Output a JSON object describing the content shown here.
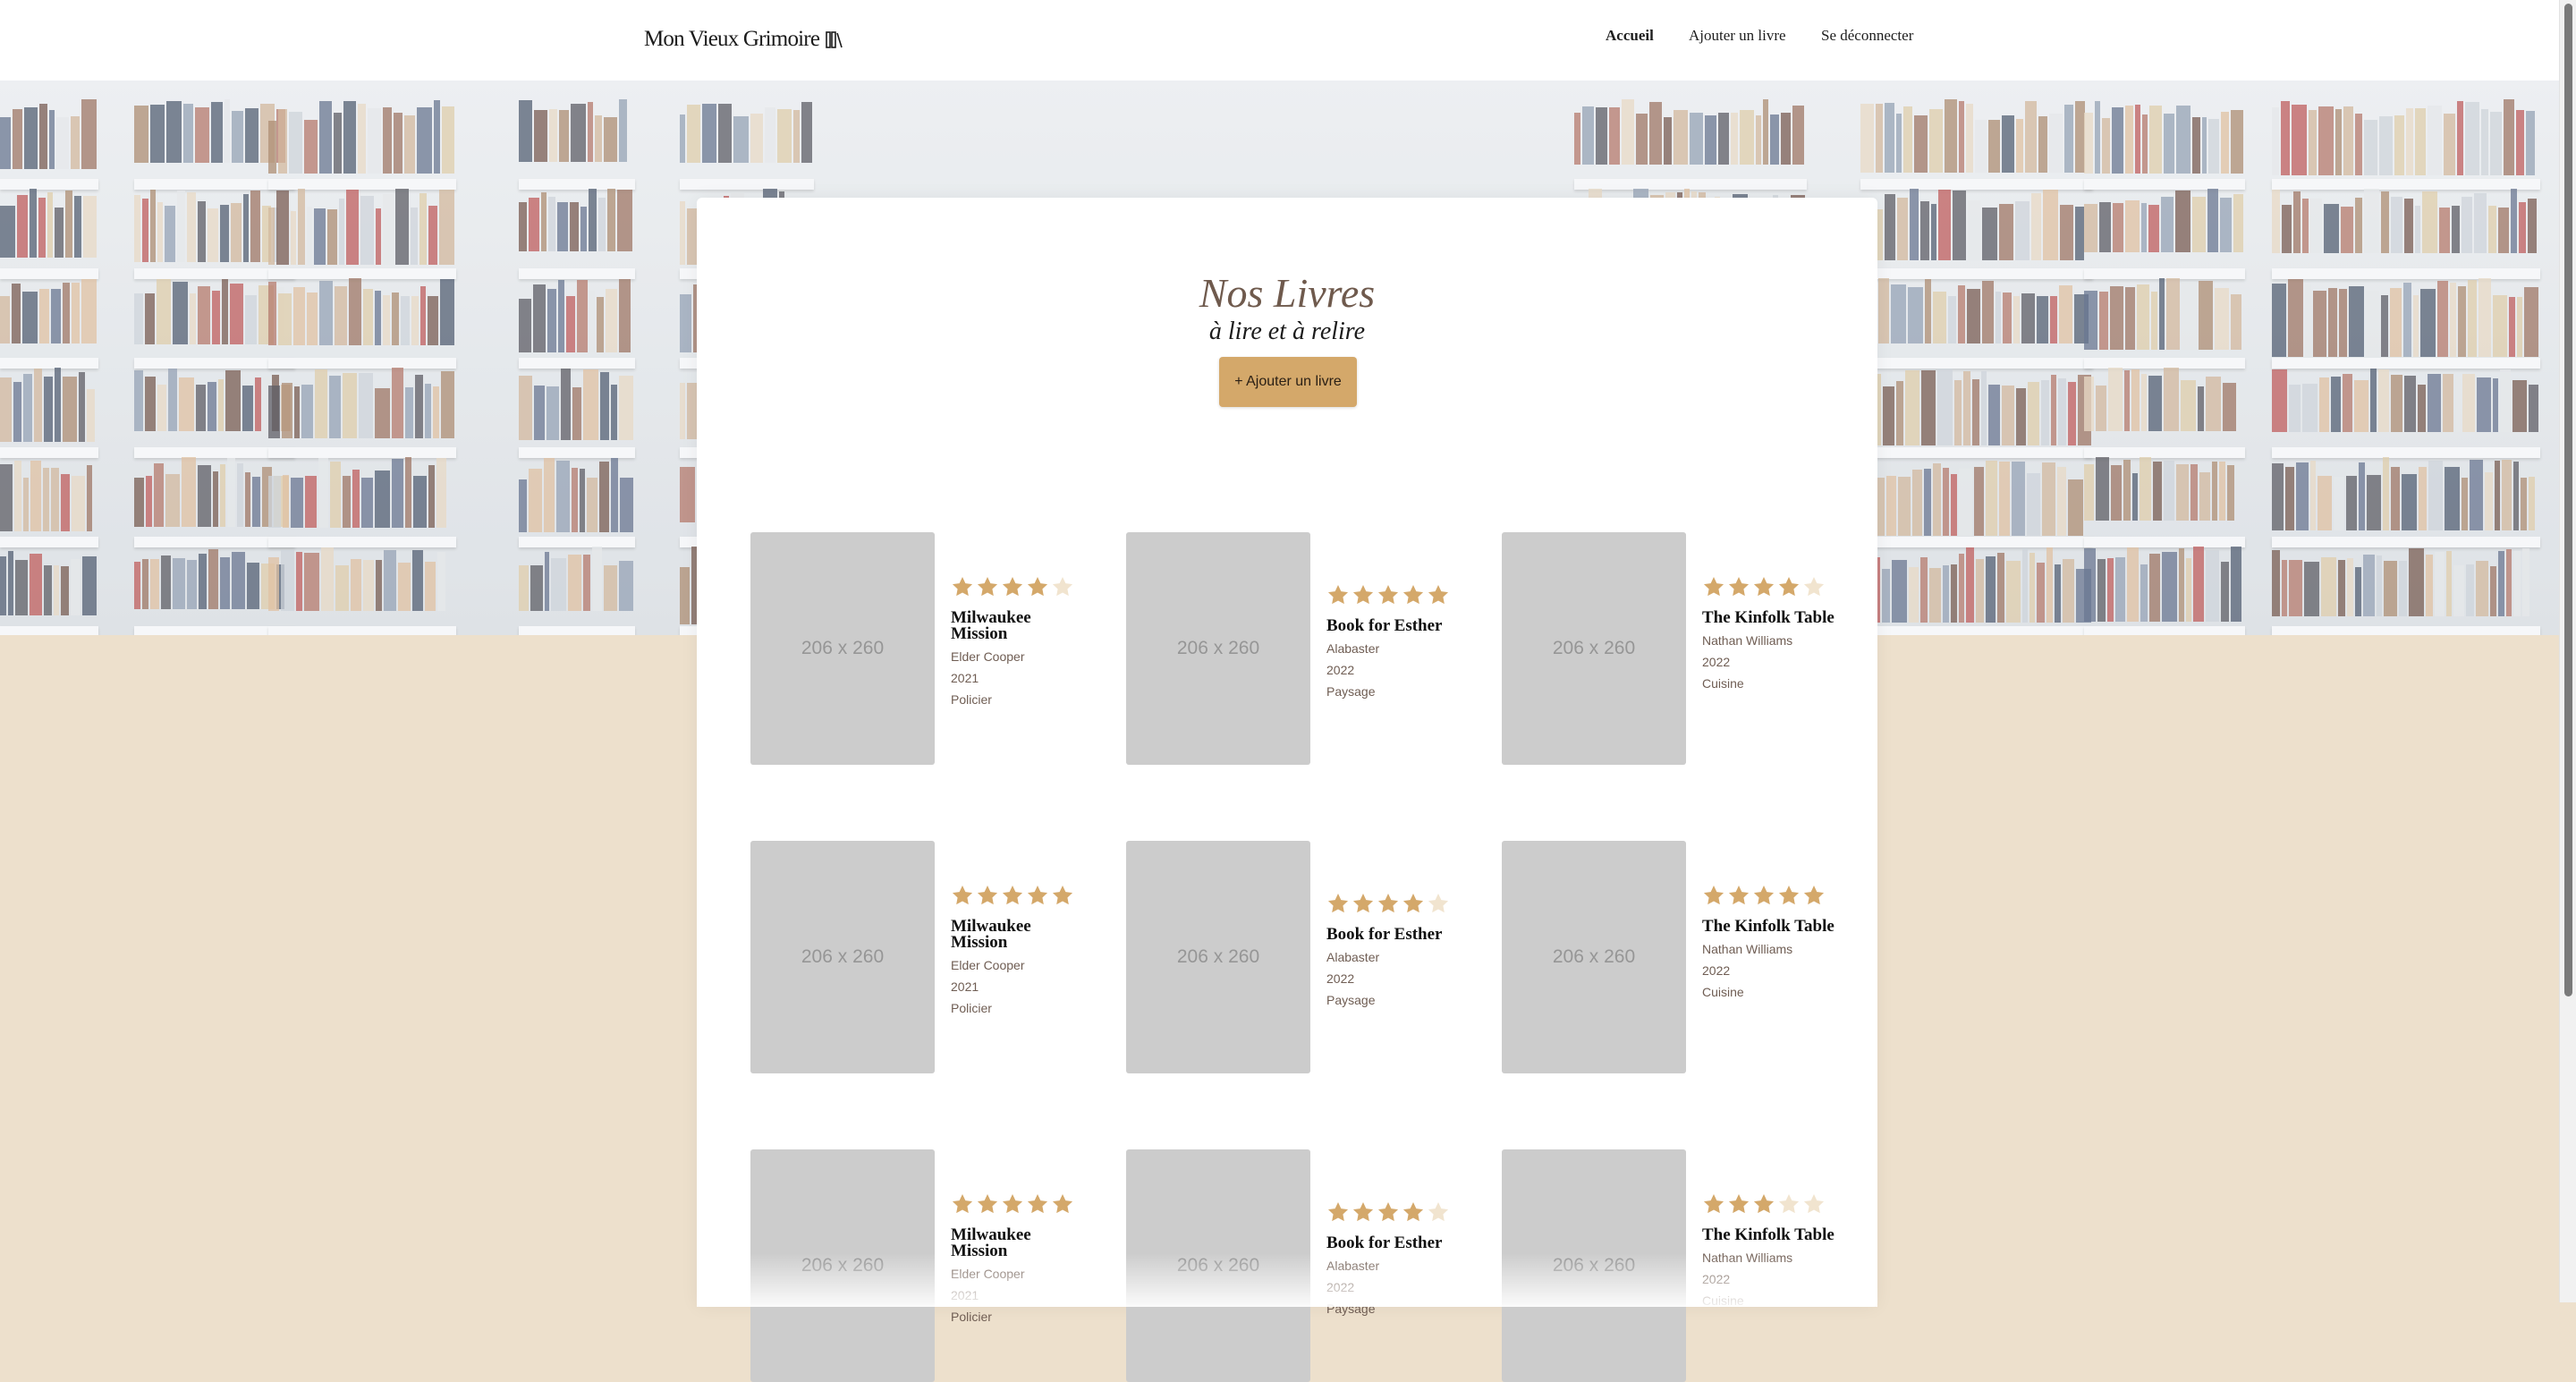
{
  "header": {
    "logo_text": "Mon Vieux Grimoire",
    "nav": [
      {
        "label": "Accueil",
        "active": true
      },
      {
        "label": "Ajouter un livre",
        "active": false
      },
      {
        "label": "Se déconnecter",
        "active": false
      }
    ]
  },
  "main": {
    "title": "Nos Livres",
    "subtitle": "à lire et à relire",
    "add_button": "+ Ajouter un livre"
  },
  "colors": {
    "accent": "#d4a86a",
    "star_filled": "#d4a86a",
    "star_empty": "#f1e4cf",
    "page_bg": "#ede0cc",
    "title": "#6f5a4d"
  },
  "books": [
    {
      "rating": 4,
      "title": "Milwaukee Mission",
      "author": "Elder Cooper",
      "year": "2021",
      "genre": "Policier",
      "cover_text": "206 x 260"
    },
    {
      "rating": 5,
      "title": "Book for Esther",
      "author": "Alabaster",
      "year": "2022",
      "genre": "Paysage",
      "cover_text": "206 x 260"
    },
    {
      "rating": 4,
      "title": "The Kinfolk Table",
      "author": "Nathan Williams",
      "year": "2022",
      "genre": "Cuisine",
      "cover_text": "206 x 260"
    },
    {
      "rating": 5,
      "title": "Milwaukee Mission",
      "author": "Elder Cooper",
      "year": "2021",
      "genre": "Policier",
      "cover_text": "206 x 260"
    },
    {
      "rating": 4,
      "title": "Book for Esther",
      "author": "Alabaster",
      "year": "2022",
      "genre": "Paysage",
      "cover_text": "206 x 260"
    },
    {
      "rating": 5,
      "title": "The Kinfolk Table",
      "author": "Nathan Williams",
      "year": "2022",
      "genre": "Cuisine",
      "cover_text": "206 x 260"
    },
    {
      "rating": 5,
      "title": "Milwaukee Mission",
      "author": "Elder Cooper",
      "year": "2021",
      "genre": "Policier",
      "cover_text": "206 x 260"
    },
    {
      "rating": 4,
      "title": "Book for Esther",
      "author": "Alabaster",
      "year": "2022",
      "genre": "Paysage",
      "cover_text": "206 x 260"
    },
    {
      "rating": 3,
      "title": "The Kinfolk Table",
      "author": "Nathan Williams",
      "year": "2022",
      "genre": "Cuisine",
      "cover_text": "206 x 260"
    }
  ]
}
